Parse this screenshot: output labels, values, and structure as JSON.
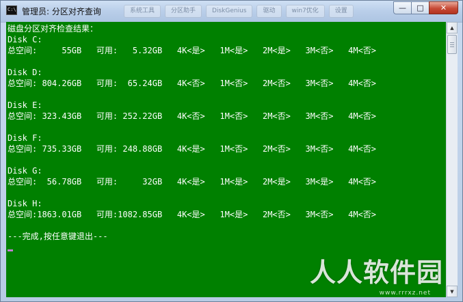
{
  "window": {
    "title": "管理员: 分区对齐查询",
    "icon_label": "C:\\.",
    "background_tabs": [
      "系统工具",
      "分区助手",
      "DiskGenius",
      "驱动",
      "win7优化",
      "设置"
    ],
    "buttons": {
      "minimize": "—",
      "maximize": "□",
      "close": "✕"
    }
  },
  "console": {
    "background": "#008000",
    "foreground": "#ffffff",
    "lines": [
      "磁盘分区对齐检查结果：",
      "Disk C:",
      "总空间:     55GB   可用:   5.32GB   4K<是>   1M<是>   2M<是>   3M<否>   4M<否>",
      "",
      "Disk D:",
      "总空间: 804.26GB   可用:  65.24GB   4K<否>   1M<否>   2M<否>   3M<否>   4M<否>",
      "",
      "Disk E:",
      "总空间: 323.43GB   可用: 252.22GB   4K<否>   1M<否>   2M<否>   3M<否>   4M<否>",
      "",
      "Disk F:",
      "总空间: 735.33GB   可用: 248.88GB   4K<是>   1M<否>   2M<否>   3M<否>   4M<否>",
      "",
      "Disk G:",
      "总空间:  56.78GB   可用:     32GB   4K<是>   1M<是>   2M<是>   3M<是>   4M<否>",
      "",
      "Disk H:",
      "总空间:1863.01GB   可用:1082.85GB   4K<是>   1M<是>   2M<否>   3M<否>   4M<否>",
      "",
      "---完成,按任意键退出---"
    ]
  },
  "watermark": {
    "text": "人人软件园",
    "url": "www.rrrxz.net"
  },
  "scrollbar": {
    "up_arrow": "▲",
    "down_arrow": "▼"
  }
}
